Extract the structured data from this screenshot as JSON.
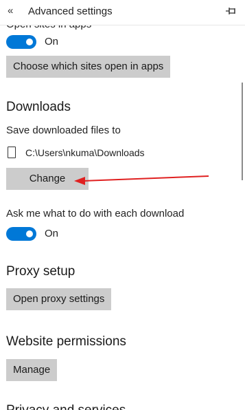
{
  "header": {
    "back_icon": "double-chevron-left-icon",
    "title": "Advanced settings",
    "pin_icon": "pin-icon"
  },
  "open_in_apps": {
    "cut_label": "Open sites in apps",
    "toggle_state": "On",
    "button_label": "Choose which sites open in apps"
  },
  "downloads": {
    "heading": "Downloads",
    "save_label": "Save downloaded files to",
    "folder_icon": "document-icon",
    "path": "C:\\Users\\nkuma\\Downloads",
    "change_button": "Change",
    "ask_label": "Ask me what to do with each download",
    "ask_toggle_state": "On"
  },
  "proxy": {
    "heading": "Proxy setup",
    "button_label": "Open proxy settings"
  },
  "permissions": {
    "heading": "Website permissions",
    "button_label": "Manage"
  },
  "privacy": {
    "heading": "Privacy and services"
  },
  "colors": {
    "accent": "#0078d7",
    "button_bg": "#cccccc",
    "annotation_arrow": "#e02020"
  }
}
